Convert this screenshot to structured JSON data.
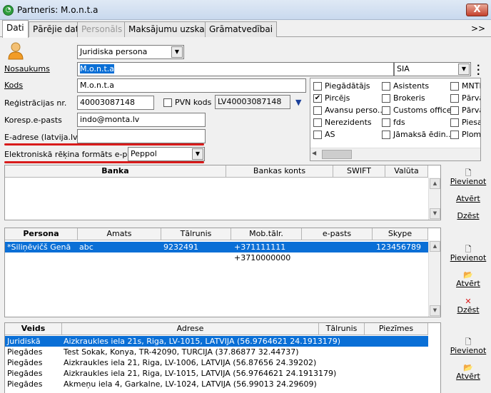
{
  "window": {
    "title": "Partneris: M.o.n.t.a",
    "close_glyph": "X"
  },
  "tabs": [
    {
      "label": "Dati",
      "active": true
    },
    {
      "label": "Pārējie dati"
    },
    {
      "label": "Personāls",
      "disabled": true
    },
    {
      "label": "Maksājumu uzskaite"
    },
    {
      "label": "Grāmatvedībai"
    }
  ],
  "tabs_more": ">>",
  "form": {
    "type_value": "Juridiska persona",
    "name_label": "Nosaukums",
    "name_value": "M.o.n.t.a",
    "legal_form_value": "SIA",
    "code_label": "Kods",
    "code_value": "M.o.n.t.a",
    "reg_label": "Reģistrācijas nr.",
    "reg_value": "40003087148",
    "vat_label": "PVN kods",
    "vat_value": "LV40003087148",
    "email_label": "Koresp.e-pasts",
    "email_value": "indo@monta.lv",
    "eaddr_label": "E-adrese (latvija.lv)",
    "eaddr_value": "",
    "einvoice_label": "Elektroniskā rēķina formāts e-pastā",
    "einvoice_value": "Peppol"
  },
  "roles": [
    {
      "label": "Piegādātājs",
      "checked": false
    },
    {
      "label": "Pircējs",
      "checked": true
    },
    {
      "label": "Avansu perso...",
      "checked": false
    },
    {
      "label": "Nerezidents",
      "checked": false
    },
    {
      "label": "AS",
      "checked": false
    },
    {
      "label": "Asistents",
      "checked": false
    },
    {
      "label": "Brokeris",
      "checked": false
    },
    {
      "label": "Customs office",
      "checked": false
    },
    {
      "label": "fds",
      "checked": false
    },
    {
      "label": "Jāmaksā ēdin...",
      "checked": false
    },
    {
      "label": "MNTH",
      "checked": false
    },
    {
      "label": "Pārva",
      "checked": false
    },
    {
      "label": "Pārva",
      "checked": false
    },
    {
      "label": "Piesai",
      "checked": false
    },
    {
      "label": "Plomb",
      "checked": false
    }
  ],
  "bank": {
    "headers": [
      "Banka",
      "Bankas konts",
      "SWIFT",
      "Valūta"
    ]
  },
  "bank_actions": {
    "add": "Pievienot",
    "open": "Atvērt",
    "delete": "Dzēst"
  },
  "persons": {
    "headers": [
      "Persona",
      "Amats",
      "Tālrunis",
      "Mob.tālr.",
      "e-pasts",
      "Skype"
    ],
    "rows": [
      {
        "persona": "*Siliņēvičš Genā",
        "amats": "abc",
        "talrunis": "9232491",
        "mob": "+371111111",
        "epasts": "",
        "skype": "123456789"
      },
      {
        "persona": "",
        "amats": "",
        "talrunis": "",
        "mob": "+3710000000",
        "epasts": "",
        "skype": ""
      }
    ]
  },
  "person_actions": {
    "add": "Pievienot",
    "open": "Atvērt",
    "delete": "Dzēst"
  },
  "addresses": {
    "headers": [
      "Veids",
      "Adrese",
      "Tālrunis",
      "Piezīmes"
    ],
    "rows": [
      {
        "veids": "Juridiskā",
        "adrese": "Aizkraukles iela 21s, Riga, LV-1015, LATVIJA (56.9764621 24.1913179)"
      },
      {
        "veids": "Piegādes",
        "adrese": "Test Sokak, Konya, TR-42090, TURCIJA (37.86877 32.44737)"
      },
      {
        "veids": "Piegādes",
        "adrese": "Aizkraukles iela 21, Riga, LV-1006, LATVIJA (56.87656 24.39202)"
      },
      {
        "veids": "Piegādes",
        "adrese": "Aizkraukles iela 21, Riga, LV-1015, LATVIJA (56.9764621 24.1913179)"
      },
      {
        "veids": "Piegādes",
        "adrese": "Akmeņu iela 4, Garkalne, LV-1024, LATVIJA (56.99013 24.29609)"
      }
    ]
  },
  "address_actions": {
    "add": "Pievienot",
    "open": "Atvērt"
  },
  "colors": {
    "selection": "#0a6fd6",
    "highlight_line": "#d81b1b"
  },
  "icons": [
    "person-icon",
    "new-document-icon",
    "open-folder-icon",
    "delete-x-icon",
    "down-arrow-icon"
  ]
}
